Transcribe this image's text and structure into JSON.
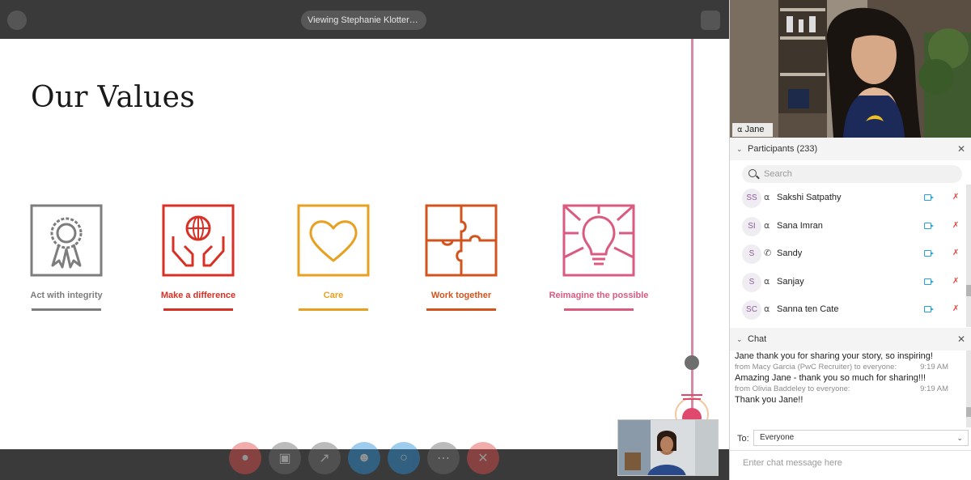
{
  "share": {
    "viewing_label": "Viewing Stephanie Klotter (P...",
    "slide_title": "Our Values",
    "values": [
      {
        "label": "Act with integrity",
        "color": "#7d7d7d",
        "icon": "ribbon-award-icon"
      },
      {
        "label": "Make a difference",
        "color": "#d93025",
        "icon": "hands-globe-icon"
      },
      {
        "label": "Care",
        "color": "#e8a020",
        "icon": "heart-icon"
      },
      {
        "label": "Work together",
        "color": "#d2541c",
        "icon": "puzzle-icon"
      },
      {
        "label": "Reimagine the possible",
        "color": "#d95b80",
        "icon": "lightbulb-icon"
      }
    ],
    "controls": [
      {
        "name": "mute-button",
        "icon": "microphone-icon",
        "color": "#e24a4a"
      },
      {
        "name": "video-button",
        "icon": "video-camera-icon",
        "color": "#6b6b6b"
      },
      {
        "name": "share-button",
        "icon": "share-icon",
        "color": "#6b6b6b"
      },
      {
        "name": "participants-button",
        "icon": "person-icon",
        "color": "#2a8fd6"
      },
      {
        "name": "chat-button",
        "icon": "chat-bubble-icon",
        "color": "#2a8fd6"
      },
      {
        "name": "more-button",
        "icon": "ellipsis-icon",
        "color": "#6b6b6b"
      },
      {
        "name": "leave-button",
        "icon": "close-icon",
        "color": "#e24a4a"
      }
    ]
  },
  "video": {
    "speaker_name": "Jane"
  },
  "participants": {
    "header": "Participants (233)",
    "search_placeholder": "Search",
    "list": [
      {
        "initials": "SS",
        "name": "Sakshi Satpathy",
        "audio": "headset"
      },
      {
        "initials": "SI",
        "name": "Sana Imran",
        "audio": "headset"
      },
      {
        "initials": "S",
        "name": "Sandy",
        "audio": "phone"
      },
      {
        "initials": "S",
        "name": "Sanjay",
        "audio": "headset"
      },
      {
        "initials": "SC",
        "name": "Sanna ten Cate",
        "audio": "headset"
      }
    ]
  },
  "chat": {
    "header": "Chat",
    "messages": [
      {
        "from": "",
        "time": "",
        "text": "Jane thank you for sharing your story, so inspiring!"
      },
      {
        "from": "from Macy Garcia (PwC Recruiter) to everyone:",
        "time": "9:19 AM",
        "text": "Amazing Jane - thank you so much for sharing!!!"
      },
      {
        "from": "from Olivia Baddeley to everyone:",
        "time": "9:19 AM",
        "text": "Thank you Jane!!"
      }
    ],
    "to_label": "To:",
    "to_value": "Everyone",
    "input_placeholder": "Enter chat message here"
  }
}
